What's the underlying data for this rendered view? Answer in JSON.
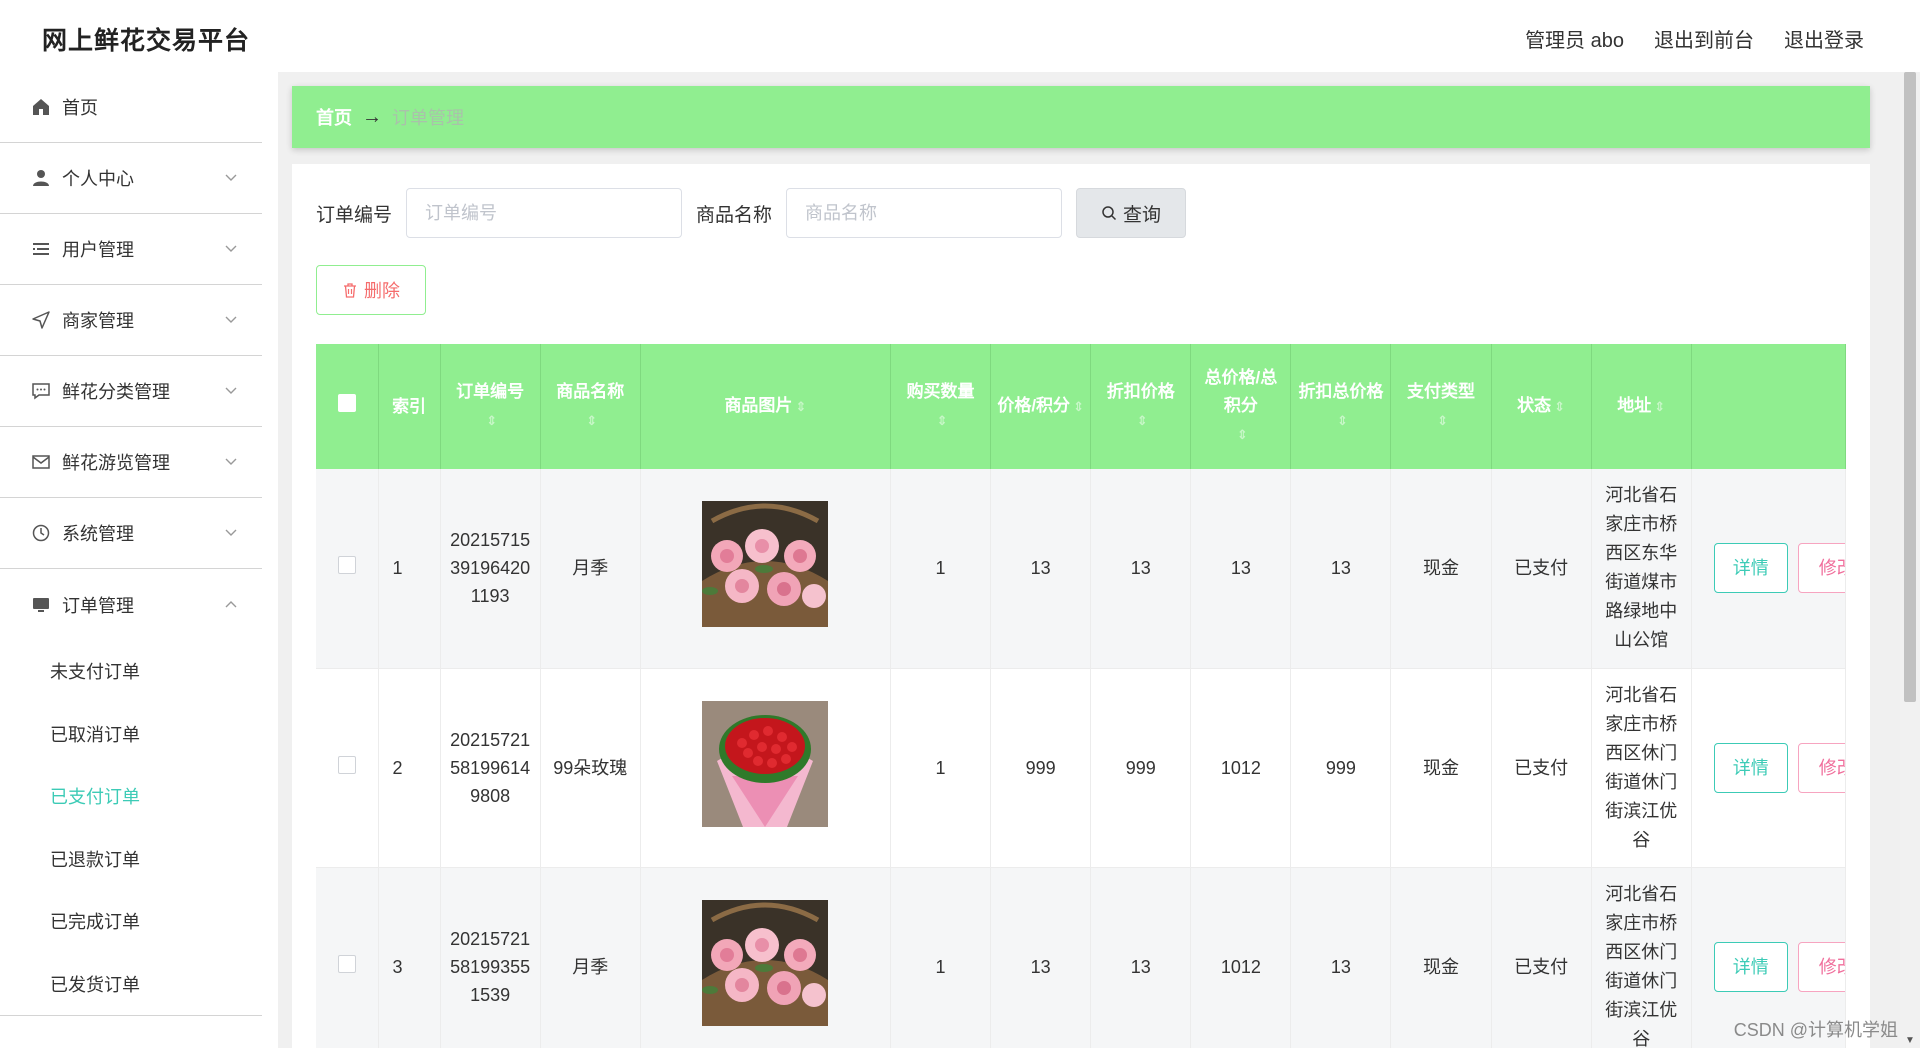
{
  "header": {
    "title": "网上鲜花交易平台",
    "admin": "管理员 abo",
    "front": "退出到前台",
    "logout": "退出登录"
  },
  "sidebar": {
    "items": [
      {
        "label": "首页",
        "icon": "home-icon"
      },
      {
        "label": "个人中心",
        "icon": "user-icon"
      },
      {
        "label": "用户管理",
        "icon": "list-icon"
      },
      {
        "label": "商家管理",
        "icon": "send-icon"
      },
      {
        "label": "鲜花分类管理",
        "icon": "chat-icon"
      },
      {
        "label": "鲜花游览管理",
        "icon": "mail-icon"
      },
      {
        "label": "系统管理",
        "icon": "clock-icon"
      },
      {
        "label": "订单管理",
        "icon": "monitor-icon"
      }
    ],
    "sub_items": [
      "未支付订单",
      "已取消订单",
      "已支付订单",
      "已退款订单",
      "已完成订单",
      "已发货订单"
    ],
    "active_sub": "已支付订单"
  },
  "breadcrumb": {
    "home": "首页",
    "arrow": "→",
    "current": "订单管理"
  },
  "search": {
    "order_label": "订单编号",
    "order_placeholder": "订单编号",
    "product_label": "商品名称",
    "product_placeholder": "商品名称",
    "query_label": "查询"
  },
  "delete_label": "删除",
  "table": {
    "headers": [
      "索引",
      "订单编号",
      "商品名称",
      "商品图片",
      "购买数量",
      "价格/积分",
      "折扣价格",
      "总价格/总积分",
      "折扣总价格",
      "支付类型",
      "状态",
      "地址"
    ],
    "rows": [
      {
        "index": "1",
        "order_no": "20215715391964201193",
        "product": "月季",
        "image": "pink-roses-basket",
        "qty": "1",
        "price": "13",
        "discount": "13",
        "total": "13",
        "discount_total": "13",
        "pay_type": "现金",
        "status": "已支付",
        "address": "河北省石家庄市桥西区东华街道煤市路绿地中山公馆"
      },
      {
        "index": "2",
        "order_no": "20215721581996149808",
        "product": "99朵玫瑰",
        "image": "red-roses-bouquet",
        "qty": "1",
        "price": "999",
        "discount": "999",
        "total": "1012",
        "discount_total": "999",
        "pay_type": "现金",
        "status": "已支付",
        "address": "河北省石家庄市桥西区休门街道休门街滨江优谷"
      },
      {
        "index": "3",
        "order_no": "20215721581993551539",
        "product": "月季",
        "image": "pink-roses-basket",
        "qty": "1",
        "price": "13",
        "discount": "13",
        "total": "1012",
        "discount_total": "13",
        "pay_type": "现金",
        "status": "已支付",
        "address": "河北省石家庄市桥西区休门街道休门街滨江优谷"
      }
    ],
    "detail_label": "详情",
    "edit_label": "修改"
  },
  "watermark": "CSDN @计算机学姐",
  "colors": {
    "accent_green": "#90ee90",
    "teal": "#3ccbb6",
    "danger": "#f56c6c"
  }
}
